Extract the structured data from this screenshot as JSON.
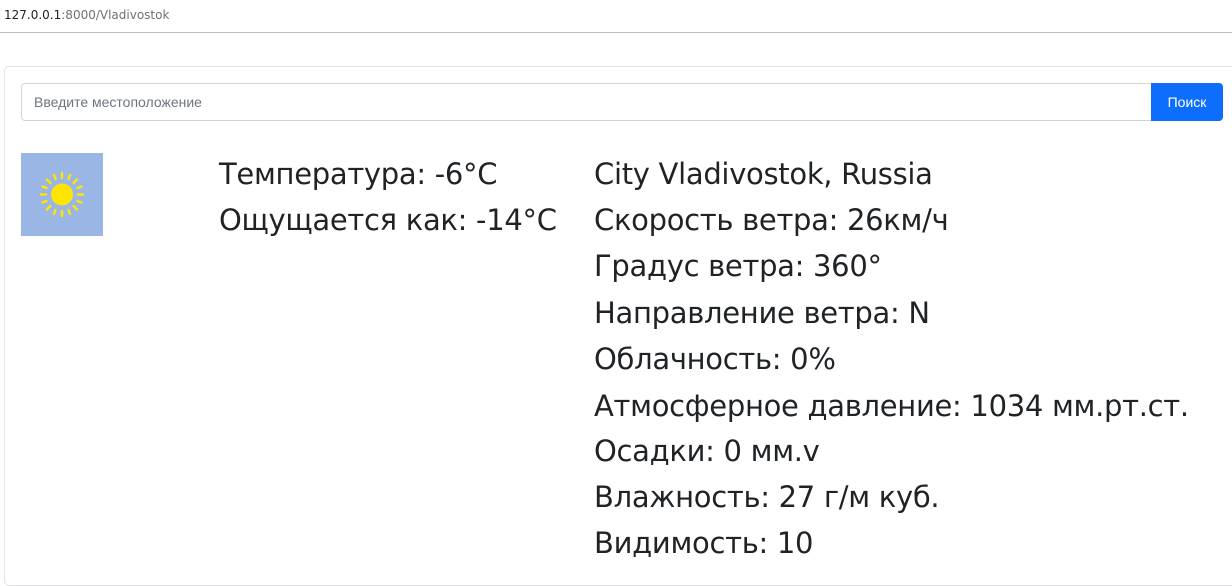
{
  "browser": {
    "url_host": "127.0.0.1",
    "url_path": ":8000/Vladivostok"
  },
  "search": {
    "placeholder": "Введите местоположение",
    "value": "",
    "button_label": "Поиск"
  },
  "weather_icon": "sun-icon",
  "colors": {
    "primary": "#0d6efd",
    "icon_background": "#9ab6e4",
    "sun": "#ffe400"
  },
  "weather": {
    "temperature": "Температура: -6°C",
    "feels_like": "Ощущается как: -14°C",
    "city": "City Vladivostok, Russia",
    "wind_speed": "Скорость ветра: 26км/ч",
    "wind_degree": "Градус ветра: 360°",
    "wind_direction": "Направление ветра: N",
    "cloudiness": "Облачность: 0%",
    "pressure": "Атмосферное давление: 1034 мм.рт.ст.",
    "precipitation": "Осадки: 0 мм.v",
    "humidity": "Влажность: 27 г/м куб.",
    "visibility": "Видимость: 10"
  }
}
